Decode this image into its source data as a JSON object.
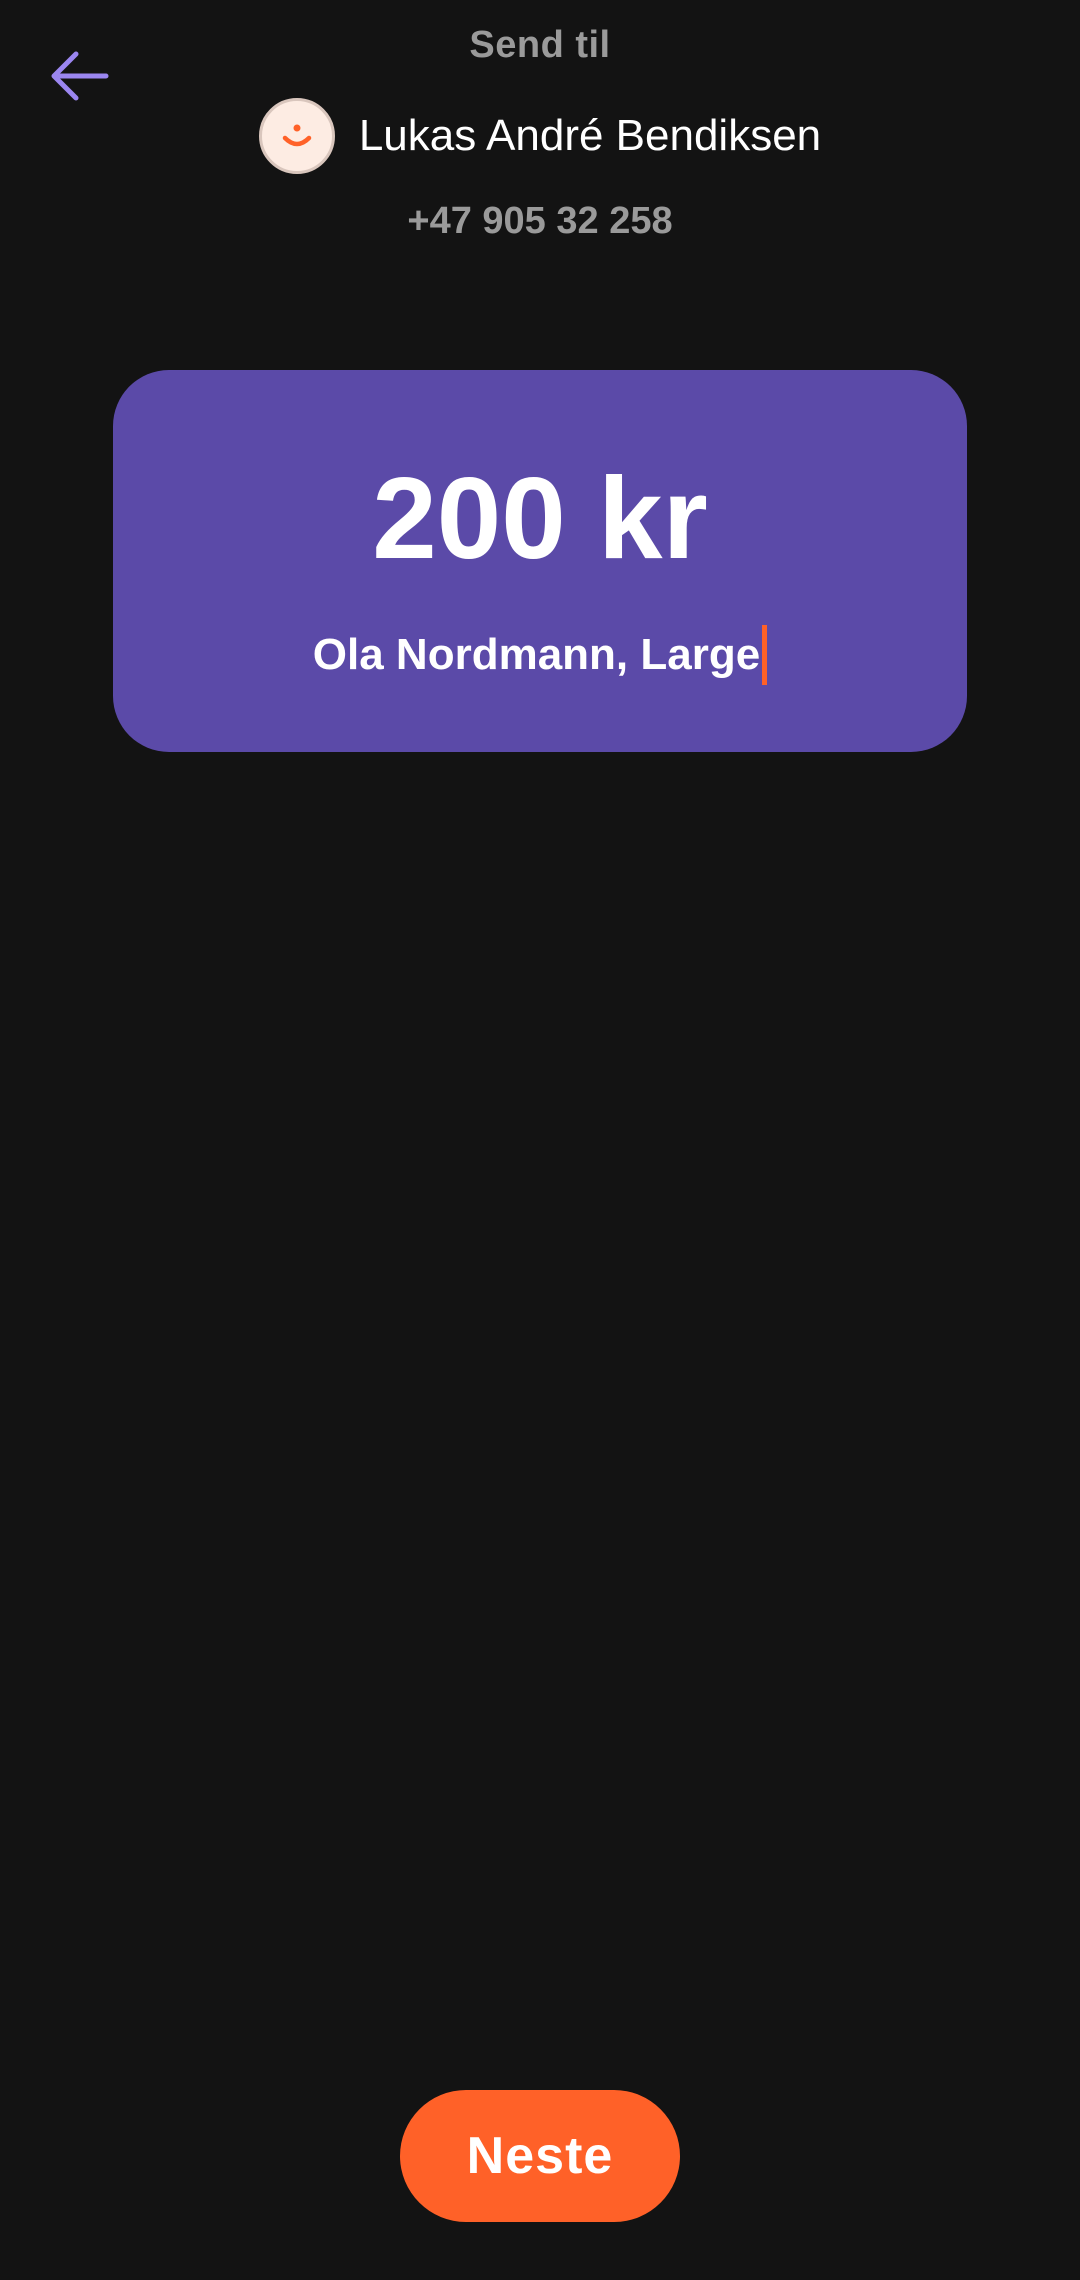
{
  "header": {
    "back_icon": "arrow-left-icon",
    "title": "Send til"
  },
  "recipient": {
    "avatar_icon": "smiley-icon",
    "name": "Lukas André Bendiksen",
    "phone": "+47 905 32 258"
  },
  "payment": {
    "amount": "200 kr",
    "message": "Ola Nordmann, Large"
  },
  "footer": {
    "next_label": "Neste"
  },
  "colors": {
    "background": "#131313",
    "card": "#5b4aa8",
    "accent": "#ff6128",
    "back_arrow": "#9b86f0",
    "muted_text": "#9a9a9a"
  }
}
